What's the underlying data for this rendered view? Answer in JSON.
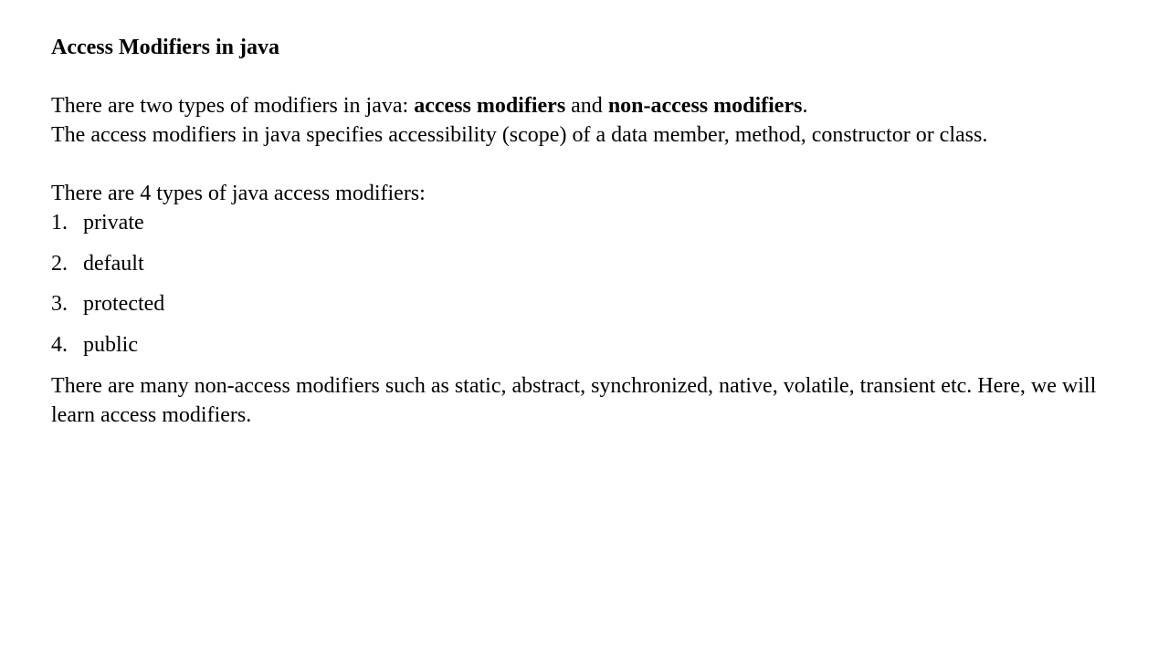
{
  "heading": "Access Modifiers in java",
  "intro": {
    "line1_prefix": "There are two types of modifiers in java: ",
    "line1_bold1": "access modifiers",
    "line1_mid": " and ",
    "line1_bold2": "non-access modifiers",
    "line1_suffix": ".",
    "line2": "The access modifiers in java specifies accessibility (scope) of a data member, method, constructor or class."
  },
  "types_lead": "There are 4 types of java access modifiers:",
  "modifiers": [
    {
      "num": "1.",
      "label": "private"
    },
    {
      "num": "2.",
      "label": "default"
    },
    {
      "num": "3.",
      "label": "protected"
    },
    {
      "num": "4.",
      "label": "public"
    }
  ],
  "outro": "There are many non-access modifiers such as static, abstract, synchronized, native, volatile, transient etc. Here, we will learn access modifiers."
}
